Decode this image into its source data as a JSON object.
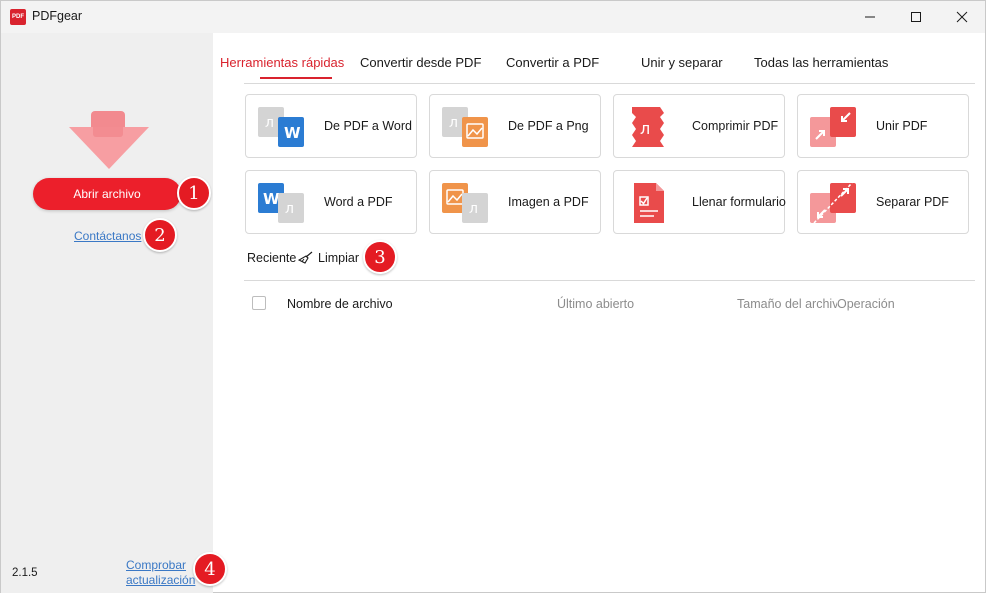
{
  "app": {
    "title": "PDFgear",
    "logo_text": "PDF"
  },
  "sidebar": {
    "open_button": "Abrir archivo",
    "contact_link": "Contáctanos",
    "version": "2.1.5",
    "update_link": "Comprobar actualización"
  },
  "tabs": [
    {
      "label": "Herramientas rápidas",
      "active": true
    },
    {
      "label": "Convertir desde PDF",
      "active": false
    },
    {
      "label": "Convertir a PDF",
      "active": false
    },
    {
      "label": "Unir y separar",
      "active": false
    },
    {
      "label": "Todas las herramientas",
      "active": false
    }
  ],
  "tools": [
    {
      "label": "De PDF a Word",
      "icon": "pdf-to-word-icon"
    },
    {
      "label": "De PDF a Png",
      "icon": "pdf-to-png-icon"
    },
    {
      "label": "Comprimir PDF",
      "icon": "compress-pdf-icon"
    },
    {
      "label": "Unir PDF",
      "icon": "merge-pdf-icon"
    },
    {
      "label": "Word a PDF",
      "icon": "word-to-pdf-icon"
    },
    {
      "label": "Imagen a PDF",
      "icon": "image-to-pdf-icon"
    },
    {
      "label": "Llenar formulario",
      "icon": "fill-form-icon"
    },
    {
      "label": "Separar PDF",
      "icon": "split-pdf-icon"
    }
  ],
  "recent": {
    "label": "Reciente",
    "clear_label": "Limpiar",
    "columns": {
      "name": "Nombre de archivo",
      "last_opened": "Último abierto",
      "size": "Tamaño del archivo",
      "operation": "Operación"
    }
  },
  "badges": [
    "1",
    "2",
    "3",
    "4"
  ],
  "colors": {
    "accent": "#d9232e",
    "button": "#ec1f2b",
    "link": "#3a78c5",
    "word_blue": "#2b7cd3",
    "image_orange": "#f0944a"
  }
}
